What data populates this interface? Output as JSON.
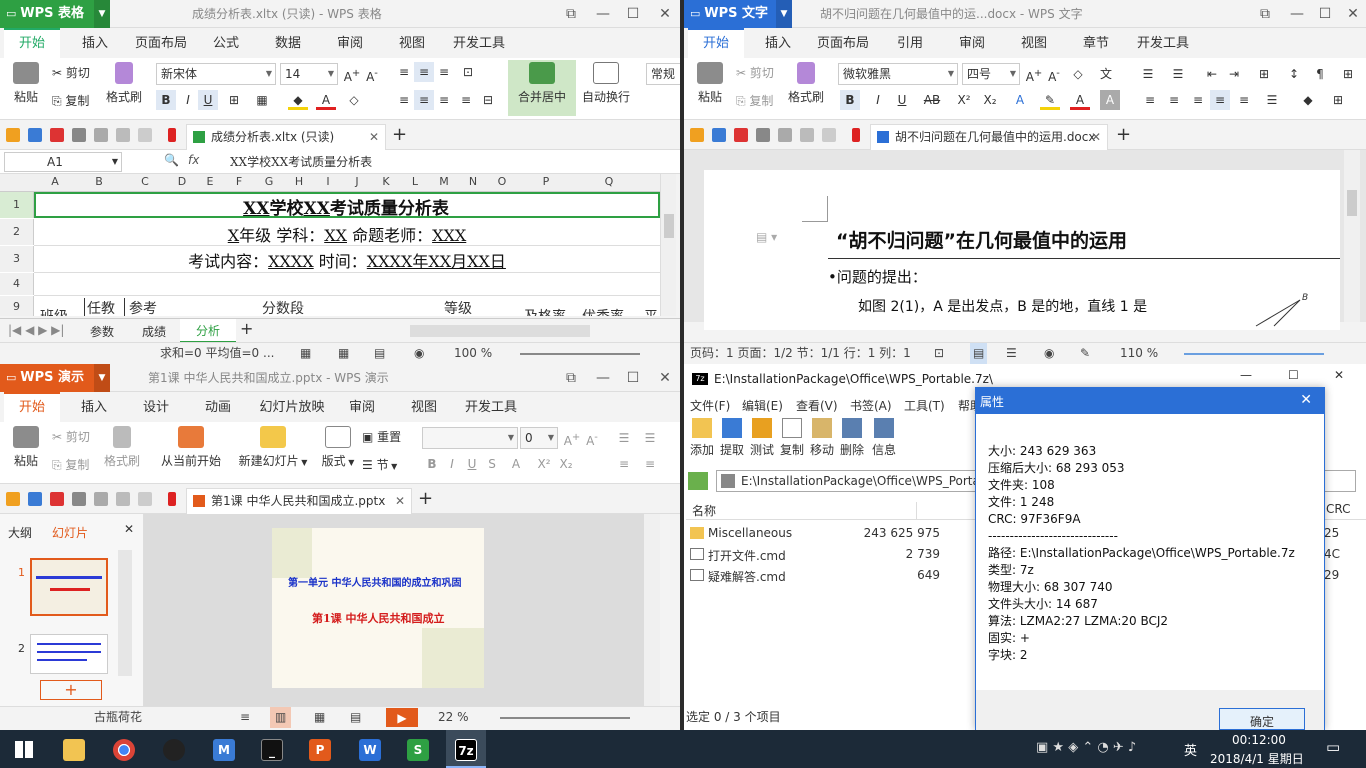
{
  "colors": {
    "et_green": "#2ea043",
    "wps_word_blue": "#2b6fd6",
    "wpp_orange": "#e25a1b",
    "taskbar": "#1c2a38"
  },
  "et": {
    "app": "WPS 表格",
    "title": "成绩分析表.xltx (只读) - WPS 表格",
    "tabs": [
      "开始",
      "插入",
      "页面布局",
      "公式",
      "数据",
      "审阅",
      "视图",
      "开发工具"
    ],
    "paste": "粘贴",
    "cut": "剪切",
    "copy": "复制",
    "format_painter": "格式刷",
    "font": "新宋体",
    "size": "14",
    "merge": "合并居中",
    "wrap": "自动换行",
    "normal": "常规",
    "doc_tab": "成绩分析表.xltx (只读)",
    "cellref": "A1",
    "fx": "fx",
    "formula": "XX学校XX考试质量分析表",
    "cols": [
      "A",
      "B",
      "C",
      "D",
      "E",
      "F",
      "G",
      "H",
      "I",
      "J",
      "K",
      "L",
      "M",
      "N",
      "O",
      "P",
      "Q"
    ],
    "rows": [
      "1",
      "2",
      "3",
      "4",
      "9"
    ],
    "r1a": "XX",
    "r1b": "学校",
    "r1c": "XX",
    "r1d": "考试质量分析表",
    "r2a": "X",
    "r2b": "年级  学科：",
    "r2c": "XX",
    "r2d": " 命题老师：",
    "r2e": "XXX",
    "r3a": "考试内容：",
    "r3b": "XXXX",
    "r3c": " 时间：",
    "r3d": "XXXX年XX月XX日",
    "r9": [
      "班级",
      "任教",
      "参考",
      "分数段",
      "等级",
      "及格率",
      "优秀率",
      "平"
    ],
    "sheets": [
      "参数",
      "成绩",
      "分析"
    ],
    "status": "求和=0  平均值=0 ...",
    "zoom": "100 %"
  },
  "wps": {
    "app": "WPS 文字",
    "title": "胡不归问题在几何最值中的运...docx - WPS 文字",
    "tabs": [
      "开始",
      "插入",
      "页面布局",
      "引用",
      "审阅",
      "视图",
      "章节",
      "开发工具"
    ],
    "paste": "粘贴",
    "cut": "剪切",
    "copy": "复制",
    "format_painter": "格式刷",
    "font": "微软雅黑",
    "size": "四号",
    "doc_tab": "胡不归问题在几何最值中的运用.docx",
    "heading": "“胡不归问题”在几何最值中的运用",
    "bullet": "•问题的提出：",
    "body": "如图 2(1)，A 是出发点，B 是的地，直线 1 是",
    "fig_label": "B",
    "status": "页码：1  页面：1/2  节：1/1  行：1  列：1",
    "zoom": "110 %"
  },
  "wpp": {
    "app": "WPS 演示",
    "title": "第1课 中华人民共和国成立.pptx - WPS 演示",
    "tabs": [
      "开始",
      "插入",
      "设计",
      "动画",
      "幻灯片放映",
      "审阅",
      "视图",
      "开发工具"
    ],
    "paste": "粘贴",
    "cut": "剪切",
    "copy": "复制",
    "format_painter": "格式刷",
    "from_current": "从当前开始",
    "new_slide": "新建幻灯片",
    "layout": "版式",
    "section": "节",
    "reset": "重置",
    "size": "0",
    "doc_tab": "第1课 中华人民共和国成立.pptx",
    "pane_tabs": [
      "大纲",
      "幻灯片"
    ],
    "slide_nums": [
      "1",
      "2"
    ],
    "slide_title": "第一单元  中华人民共和国的成立和巩固",
    "slide_sub": "第1课  中华人民共和国成立",
    "theme": "古瓶荷花",
    "zoom": "22 %"
  },
  "z7": {
    "title": "E:\\InstallationPackage\\Office\\WPS_Portable.7z\\",
    "menus": [
      "文件(F)",
      "编辑(E)",
      "查看(V)",
      "书签(A)",
      "工具(T)",
      "帮助"
    ],
    "tools": [
      "添加",
      "提取",
      "测试",
      "复制",
      "移动",
      "删除",
      "信息"
    ],
    "path": "E:\\InstallationPackage\\Office\\WPS_Porta",
    "headers": [
      "名称",
      "大小",
      "CRC"
    ],
    "files": [
      {
        "name": "Miscellaneous",
        "size": "243 625 975",
        "crc": "25"
      },
      {
        "name": "打开文件.cmd",
        "size": "2 739",
        "crc": "4C"
      },
      {
        "name": "疑难解答.cmd",
        "size": "649",
        "crc": "29"
      }
    ],
    "status": "选定 0 / 3 个项目"
  },
  "props": {
    "title": "属性",
    "lines": [
      "大小: 243 629 363",
      "压缩后大小: 68 293 053",
      "文件夹: 108",
      "文件: 1 248",
      "CRC: 97F36F9A",
      "------------------------------",
      "路径: E:\\InstallationPackage\\Office\\WPS_Portable.7z",
      "类型: 7z",
      "物理大小: 68 307 740",
      "文件头大小: 14 687",
      "算法: LZMA2:27 LZMA:20 BCJ2",
      "固实: +",
      "字块: 2"
    ],
    "ok": "确定"
  },
  "taskbar": {
    "time": "00:12:00",
    "date": "2018/4/1 星期日",
    "ime": "英"
  }
}
